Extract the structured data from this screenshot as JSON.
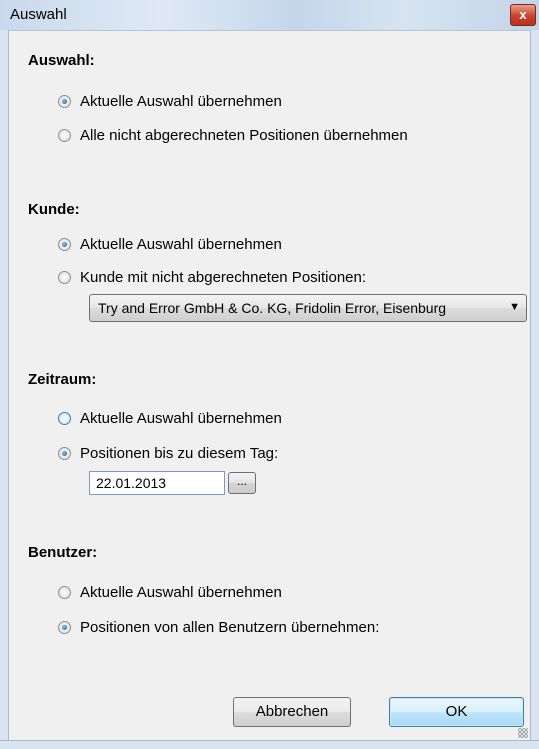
{
  "window": {
    "title": "Auswahl",
    "close_label": "x"
  },
  "auswahl": {
    "heading": "Auswahl:",
    "options": [
      "Aktuelle Auswahl übernehmen",
      "Alle nicht abgerechneten Positionen übernehmen"
    ],
    "selected": 0
  },
  "kunde": {
    "heading": "Kunde:",
    "options": [
      "Aktuelle Auswahl übernehmen",
      "Kunde mit nicht abgerechneten Positionen:"
    ],
    "selected": 0,
    "combo_value": "Try and Error GmbH & Co. KG, Fridolin Error, Eisenburg",
    "combo_arrow": "▼"
  },
  "zeitraum": {
    "heading": "Zeitraum:",
    "options": [
      "Aktuelle Auswahl übernehmen",
      "Positionen bis zu diesem Tag:"
    ],
    "selected": 1,
    "date_value": "22.01.2013",
    "browse_label": "..."
  },
  "benutzer": {
    "heading": "Benutzer:",
    "options": [
      "Aktuelle Auswahl übernehmen",
      "Positionen von allen Benutzern übernehmen:"
    ],
    "selected": 1
  },
  "buttons": {
    "cancel": "Abbrechen",
    "ok": "OK"
  }
}
